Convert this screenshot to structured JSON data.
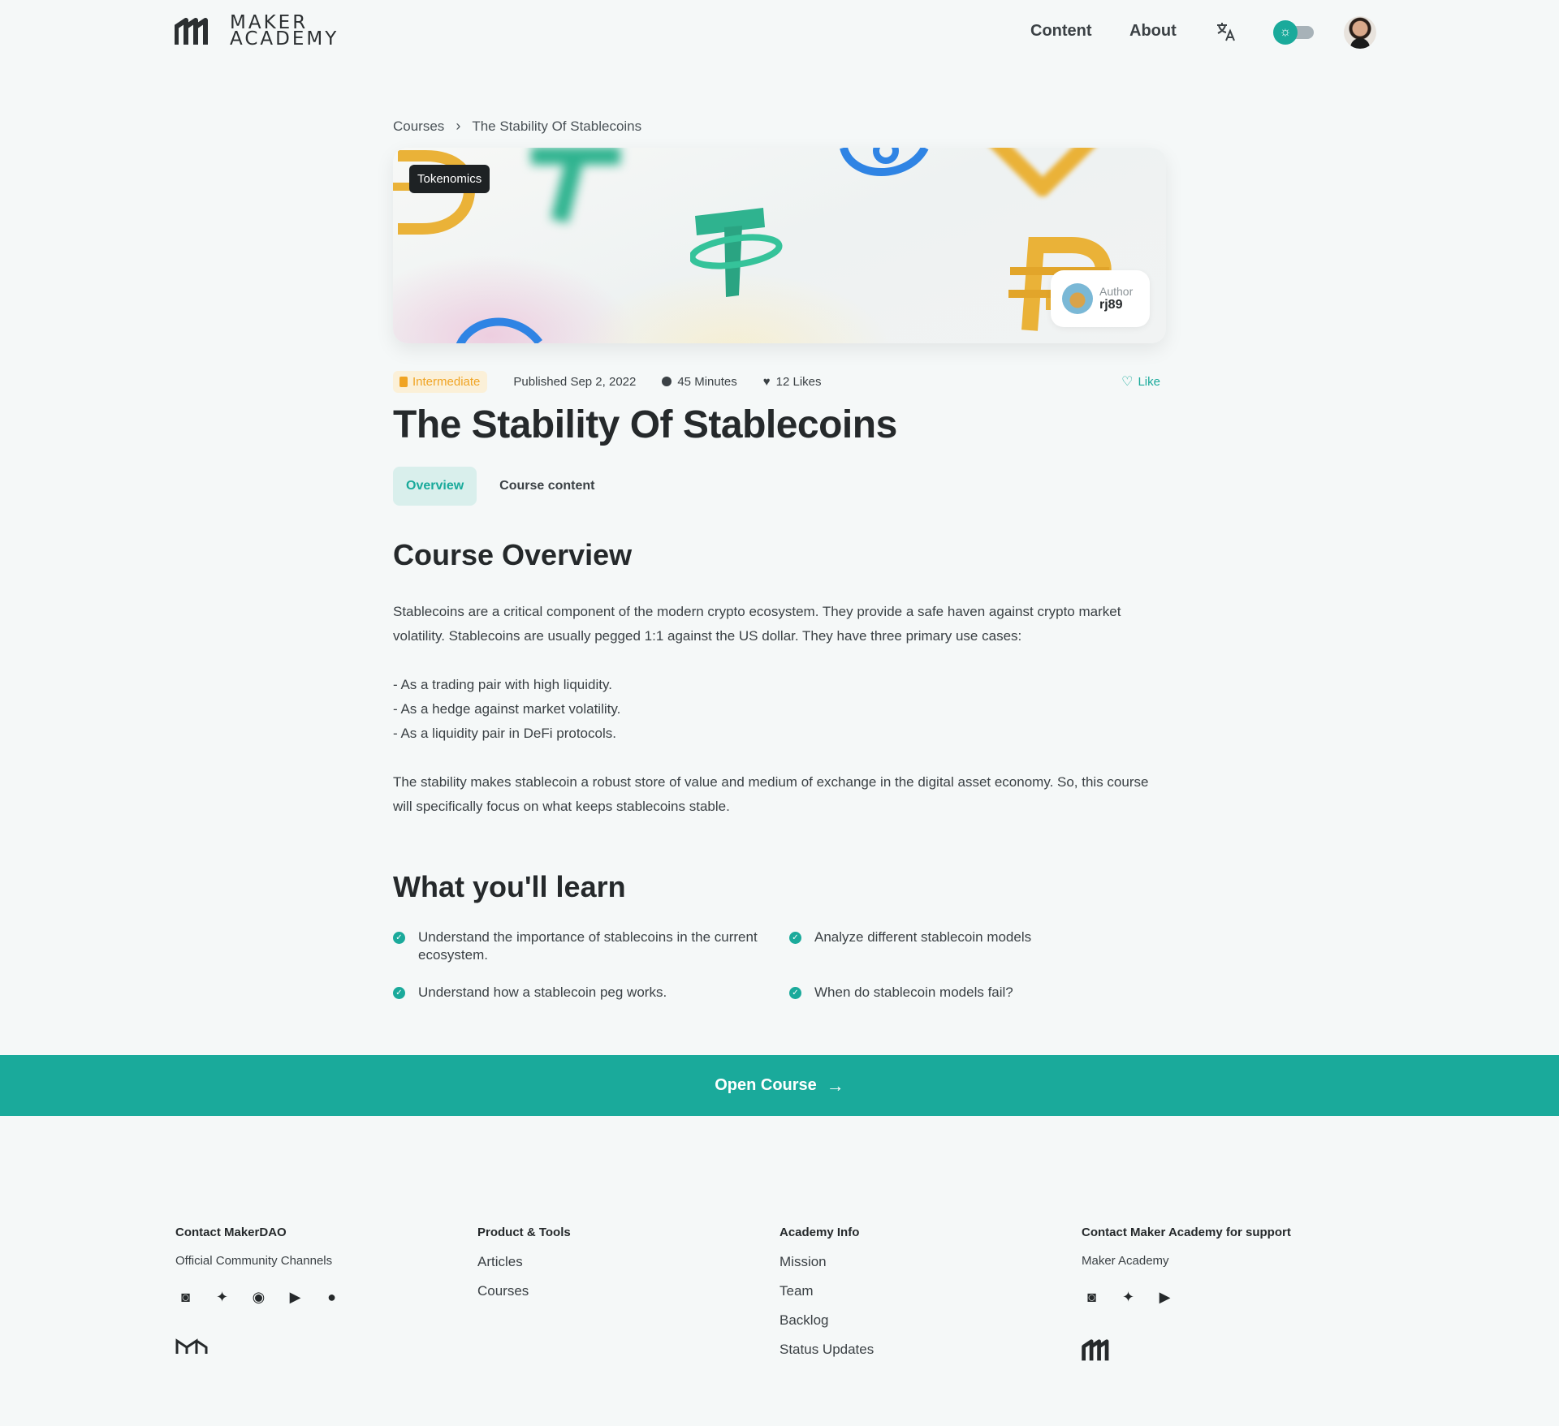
{
  "header": {
    "logo_line1": "MAKER",
    "logo_line2": "ACADEMY",
    "nav": [
      "Content",
      "About"
    ],
    "translate_icon": "translate-icon",
    "theme_toggle": "light",
    "accent": "#1aaa9b"
  },
  "breadcrumb": {
    "root": "Courses",
    "current": "The Stability Of Stablecoins"
  },
  "hero": {
    "tag": "Tokenomics",
    "author_label": "Author",
    "author_name": "rj89"
  },
  "meta": {
    "level": "Intermediate",
    "published": "Published Sep 2, 2022",
    "duration": "45 Minutes",
    "likes": "12 Likes",
    "like_action": "Like"
  },
  "title": "The Stability Of Stablecoins",
  "tabs": [
    "Overview",
    "Course content"
  ],
  "overview": {
    "heading": "Course Overview",
    "intro": "Stablecoins are a critical component of the modern crypto ecosystem. They provide a safe haven against crypto market volatility. Stablecoins are usually pegged 1:1 against the US dollar. They have three primary use cases:",
    "uses": [
      "- As a trading pair with high liquidity.",
      "- As a hedge against market volatility.",
      "- As a liquidity pair in DeFi protocols."
    ],
    "closing": "The stability makes stablecoin a robust store of value and medium of exchange in the digital asset economy. So, this course will specifically focus on what keeps stablecoins stable."
  },
  "learn": {
    "heading": "What you'll learn",
    "items": [
      "Understand the importance of stablecoins in the current ecosystem.",
      "Analyze different stablecoin models",
      "Understand how a stablecoin peg works.",
      "When do stablecoin models fail?"
    ]
  },
  "cta": {
    "label": "Open Course"
  },
  "footer": {
    "col1": {
      "heading": "Contact MakerDAO",
      "sub": "Official Community Channels",
      "icons": [
        "discord-icon",
        "twitter-icon",
        "reddit-icon",
        "youtube-icon",
        "github-icon"
      ]
    },
    "col2": {
      "heading": "Product & Tools",
      "links": [
        "Articles",
        "Courses"
      ]
    },
    "col3": {
      "heading": "Academy Info",
      "links": [
        "Mission",
        "Team",
        "Backlog",
        "Status Updates"
      ]
    },
    "col4": {
      "heading": "Contact Maker Academy for support",
      "sub": "Maker Academy",
      "icons": [
        "discord-icon",
        "twitter-icon",
        "youtube-icon"
      ]
    }
  }
}
